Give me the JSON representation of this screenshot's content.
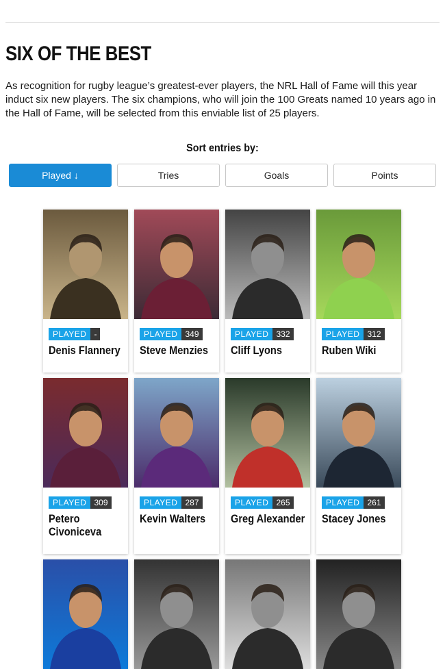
{
  "page": {
    "title": "SIX OF THE BEST",
    "intro": "As recognition for rugby league’s greatest-ever players, the NRL Hall of Fame will this year induct six new players. The six champions, who will join the 100 Greats named 10 years ago in the Hall of Fame, will be selected from this enviable list of 25 players."
  },
  "sort": {
    "label": "Sort entries by:",
    "buttons": [
      {
        "label": "Played",
        "active": true,
        "arrow": "↓"
      },
      {
        "label": "Tries",
        "active": false
      },
      {
        "label": "Goals",
        "active": false
      },
      {
        "label": "Points",
        "active": false
      }
    ]
  },
  "colors": {
    "accent": "#1a8bd6",
    "badge_label": "#1aa3e8",
    "badge_value": "#3a3a3a"
  },
  "players": [
    {
      "name": "Denis Flannery",
      "stat_label": "PLAYED",
      "stat_value": "-"
    },
    {
      "name": "Steve Menzies",
      "stat_label": "PLAYED",
      "stat_value": "349"
    },
    {
      "name": "Cliff Lyons",
      "stat_label": "PLAYED",
      "stat_value": "332"
    },
    {
      "name": "Ruben Wiki",
      "stat_label": "PLAYED",
      "stat_value": "312"
    },
    {
      "name": "Petero Civoniceva",
      "stat_label": "PLAYED",
      "stat_value": "309"
    },
    {
      "name": "Kevin Walters",
      "stat_label": "PLAYED",
      "stat_value": "287"
    },
    {
      "name": "Greg Alexander",
      "stat_label": "PLAYED",
      "stat_value": "265"
    },
    {
      "name": "Stacey Jones",
      "stat_label": "PLAYED",
      "stat_value": "261"
    },
    {
      "name": "",
      "stat_label": "",
      "stat_value": ""
    },
    {
      "name": "",
      "stat_label": "",
      "stat_value": ""
    },
    {
      "name": "",
      "stat_label": "",
      "stat_value": ""
    },
    {
      "name": "",
      "stat_label": "",
      "stat_value": ""
    }
  ]
}
